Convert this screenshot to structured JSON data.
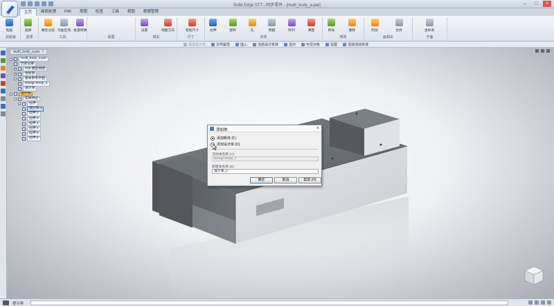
{
  "window": {
    "title": "Solid Edge ST7 - 同步零件 - [multi_body_a.par]"
  },
  "ribbon": {
    "tabs": [
      "主页",
      "曲面处理",
      "PMI",
      "草图",
      "检查",
      "工具",
      "视图",
      "数据管理"
    ],
    "active_tab": "主页",
    "groups": [
      {
        "label": "剪贴板",
        "buttons": [
          "粘贴"
        ]
      },
      {
        "label": "选择",
        "buttons": [
          "选择"
        ]
      },
      {
        "label": "工具",
        "buttons": [
          "属性过滤",
          "功能区域",
          "批量转换"
        ]
      },
      {
        "label": "绘图",
        "buttons": []
      },
      {
        "label": "相关",
        "buttons": [
          "设置",
          "视图方向"
        ]
      },
      {
        "label": "尺寸",
        "buttons": [
          "智能尺寸"
        ]
      },
      {
        "label": "实体",
        "buttons": [
          "拉伸",
          "旋转",
          "孔",
          "倒圆",
          "阵列",
          "薄壁"
        ]
      },
      {
        "label": "修改",
        "buttons": [
          "移动",
          "删除"
        ]
      },
      {
        "label": "面相关",
        "buttons": [
          "附加",
          "合并"
        ]
      },
      {
        "label": "平面",
        "buttons": [
          "坐标系"
        ]
      }
    ]
  },
  "command_bar": {
    "items": [
      {
        "label": "添加设计体",
        "dim": true
      },
      {
        "label": "文件属性",
        "dim": false
      },
      {
        "label": "插入",
        "dim": false
      },
      {
        "label": "当前设计实体",
        "dim": false
      },
      {
        "label": "显示",
        "dim": false
      },
      {
        "label": "可见对象",
        "dim": false
      },
      {
        "label": "设置",
        "dim": false
      },
      {
        "label": "添加活动实体",
        "dim": false
      }
    ]
  },
  "document": {
    "tab_label": "multi_body_a.par",
    "close_glyph": "×"
  },
  "tree": {
    "nodes": [
      {
        "label": "multi_body_a.par",
        "level": 0,
        "exp": "-",
        "style": "normal"
      },
      {
        "label": "历史记录",
        "level": 1,
        "exp": "",
        "style": "normal"
      },
      {
        "label": "PMI 模型视图",
        "level": 1,
        "exp": "+",
        "style": "normal"
      },
      {
        "label": "坐标系",
        "level": 1,
        "exp": "+",
        "style": "normal"
      },
      {
        "label": "基本参考平面",
        "level": 1,
        "exp": "-",
        "style": "normal"
      },
      {
        "label": "Design Body_1",
        "level": 2,
        "exp": "",
        "style": "normal"
      },
      {
        "label": "设计体",
        "level": 2,
        "exp": "",
        "style": "normal"
      },
      {
        "label": "设计体",
        "level": 0,
        "exp": "-",
        "style": "hl"
      },
      {
        "label": "实体特征",
        "level": 1,
        "exp": "-",
        "style": "normal"
      },
      {
        "label": "拉伸",
        "level": 2,
        "exp": "-",
        "style": "normal"
      },
      {
        "label": "设计体 1",
        "level": 3,
        "exp": "",
        "style": "sel"
      },
      {
        "label": "拉伸 1",
        "level": 3,
        "exp": "",
        "style": "normal"
      },
      {
        "label": "拉伸 2",
        "level": 3,
        "exp": "",
        "style": "normal"
      },
      {
        "label": "拉伸 3",
        "level": 3,
        "exp": "",
        "style": "normal"
      },
      {
        "label": "拉伸 4",
        "level": 3,
        "exp": "",
        "style": "normal"
      },
      {
        "label": "拉伸 5",
        "level": 3,
        "exp": "",
        "style": "normal"
      },
      {
        "label": "拉伸 6",
        "level": 3,
        "exp": "",
        "style": "normal"
      }
    ]
  },
  "dialog": {
    "title": "添加体",
    "close_glyph": "×",
    "options": [
      {
        "label": "添加新体 (F)",
        "checked": true
      },
      {
        "label": "添加设计体 (D)",
        "checked": false
      }
    ],
    "existing_label": "活动体名称 (A):",
    "existing_value": "Design Body_1",
    "new_label": "新建体名称 (B):",
    "new_value": "设计体_2",
    "buttons": {
      "ok": "确定",
      "cancel": "取消",
      "help": "帮助 (H)"
    }
  },
  "status": {
    "label": "提示条",
    "command_placeholder": ""
  },
  "colors": {
    "accent": "#2e63b3",
    "highlight": "#f3c64b",
    "model_face_top": "#6f7478",
    "model_face_front": "#d6dadf"
  },
  "icons": {
    "left_toolbar": [
      "pathfinder-icon",
      "layers-icon",
      "sensors-icon",
      "teamcenter-icon",
      "library-icon",
      "features-icon",
      "history-icon",
      "query-icon",
      "help-icon"
    ],
    "viewcube": "view-cube-icon"
  }
}
